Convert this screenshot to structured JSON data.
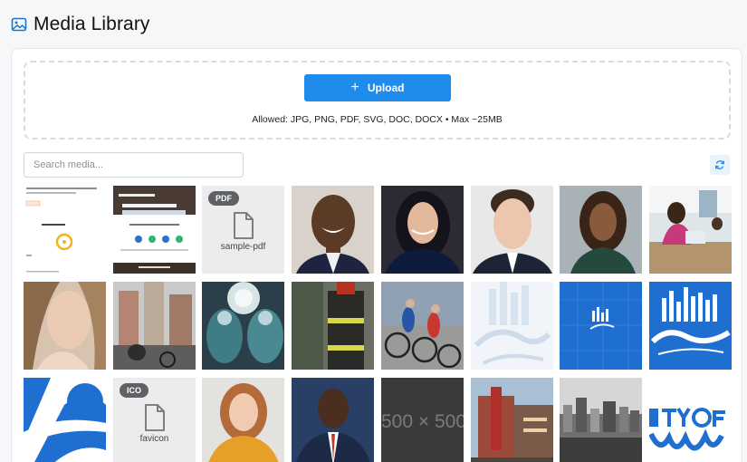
{
  "header": {
    "title": "Media Library",
    "icon": "image-icon"
  },
  "upload": {
    "button_label": "Upload",
    "allowed_text": "Allowed: JPG, PNG, PDF, SVG, DOC, DOCX • Max ~25MB"
  },
  "search": {
    "placeholder": "Search media...",
    "value": ""
  },
  "toolbar": {
    "refresh_icon": "refresh-icon"
  },
  "colors": {
    "accent": "#1f8ceb",
    "badge": "#5e6166",
    "file_tile_bg": "#ececec"
  },
  "media": [
    {
      "type": "image",
      "subject": "website screenshot"
    },
    {
      "type": "image",
      "subject": "website screenshot"
    },
    {
      "type": "file",
      "badge": "PDF",
      "name": "sample-pdf"
    },
    {
      "type": "image",
      "subject": "portrait"
    },
    {
      "type": "image",
      "subject": "portrait"
    },
    {
      "type": "image",
      "subject": "portrait"
    },
    {
      "type": "image",
      "subject": "portrait"
    },
    {
      "type": "image",
      "subject": "office"
    },
    {
      "type": "image",
      "subject": "portrait"
    },
    {
      "type": "image",
      "subject": "street"
    },
    {
      "type": "image",
      "subject": "surgery"
    },
    {
      "type": "image",
      "subject": "firefighter"
    },
    {
      "type": "image",
      "subject": "cyclists"
    },
    {
      "type": "image",
      "subject": "logo"
    },
    {
      "type": "image",
      "subject": "logo"
    },
    {
      "type": "image",
      "subject": "logo"
    },
    {
      "type": "image",
      "subject": "logo"
    },
    {
      "type": "file",
      "badge": "ICO",
      "name": "favicon"
    },
    {
      "type": "image",
      "subject": "portrait"
    },
    {
      "type": "image",
      "subject": "portrait"
    },
    {
      "type": "placeholder",
      "text": "500 × 500"
    },
    {
      "type": "image",
      "subject": "theater"
    },
    {
      "type": "image",
      "subject": "city"
    },
    {
      "type": "image",
      "subject": "logo"
    }
  ]
}
